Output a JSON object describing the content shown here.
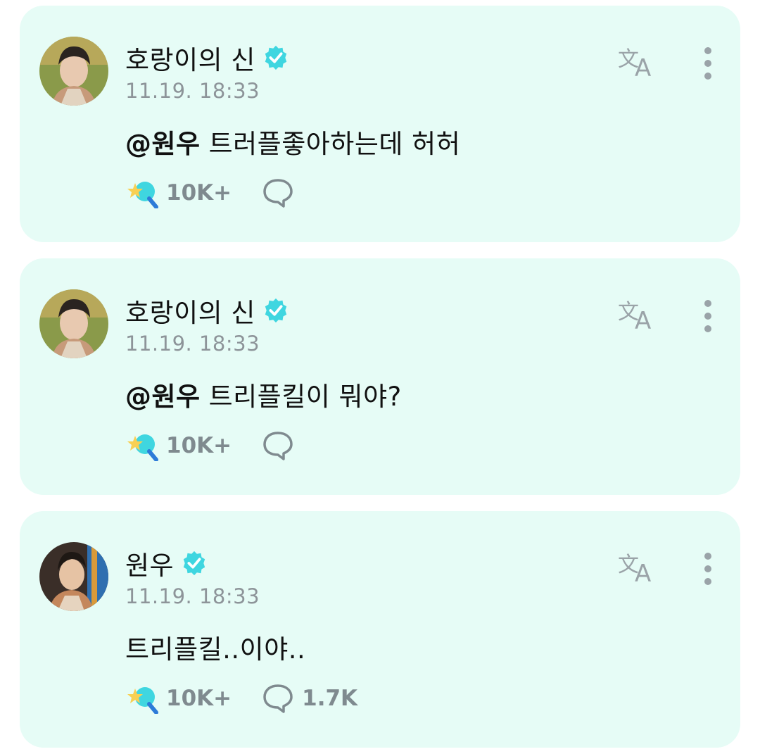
{
  "posts": [
    {
      "author": "호랑이의 신",
      "verified": true,
      "time": "11.19. 18:33",
      "mention": "@원우",
      "text": "트러플좋아하는데 허허",
      "reactions": "10K+",
      "comments": ""
    },
    {
      "author": "호랑이의 신",
      "verified": true,
      "time": "11.19. 18:33",
      "mention": "@원우",
      "text": "트리플킬이 뭐야?",
      "reactions": "10K+",
      "comments": ""
    },
    {
      "author": "원우",
      "verified": true,
      "time": "11.19. 18:33",
      "mention": "",
      "text": "트리플킬..이야..",
      "reactions": "10K+",
      "comments": "1.7K"
    }
  ],
  "icons": {
    "verified": "verified-badge-icon",
    "translate": "translate-icon",
    "more": "more-vertical-icon",
    "reaction": "star-wand-reaction-icon",
    "comment": "comment-bubble-icon"
  },
  "colors": {
    "card_background": "#e6fcf6",
    "verified_badge": "#3fd6e0",
    "secondary_text": "#8d9499",
    "icon_gray": "#9aa3a8"
  }
}
